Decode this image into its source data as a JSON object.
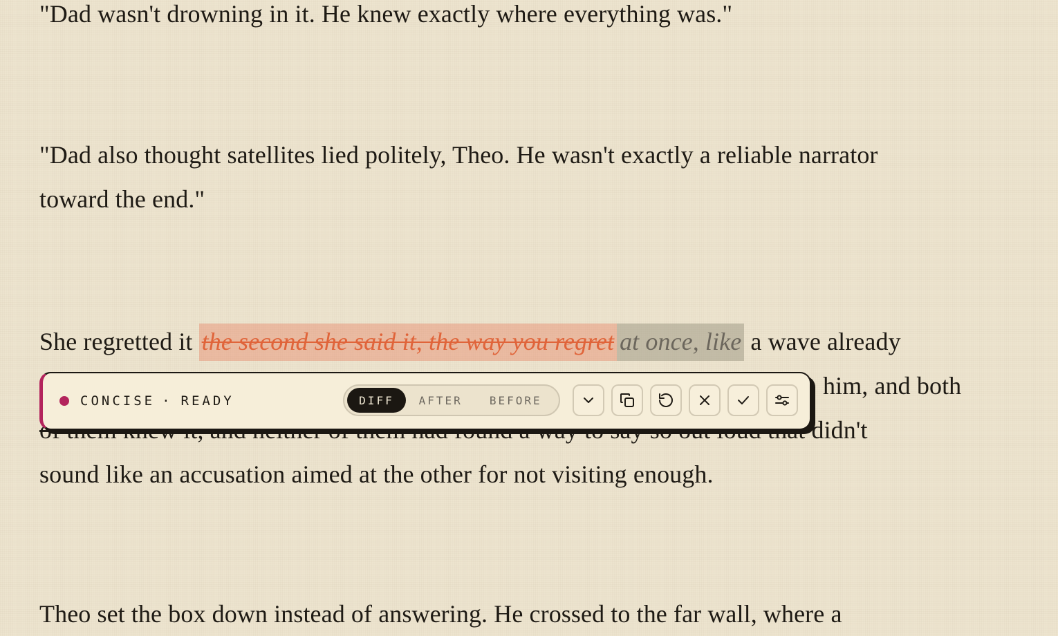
{
  "document": {
    "paragraph_1": "\"Dad wasn't drowning in it. He knew exactly where everything was.\"",
    "paragraph_2_line_1": "\"Dad also thought satellites lied politely, Theo. He wasn't exactly a reliable narrator",
    "paragraph_2_line_2": "toward the end.\"",
    "paragraph_3_prefix": "She regretted it",
    "paragraph_3_deleted": "the second she said it, the way you regret",
    "paragraph_3_inserted": "at once, like",
    "paragraph_3_line_1_rest": "a wave already",
    "paragraph_3_line_2_visible_end": "him, and both",
    "paragraph_3_line_3_struck": "of them knew it, and neither of them had found a way to say so out loud",
    "paragraph_3_line_3_end": "that didn't",
    "paragraph_3_line_4": "sound like an accusation aimed at the other for not visiting enough.",
    "paragraph_4_line_1": "Theo set the box down instead of answering. He crossed to the far wall, where a"
  },
  "toolbar": {
    "mode_label": "CONCISE",
    "separator": "·",
    "status_label": "READY",
    "accent_color": "#b3245c",
    "view_tabs": [
      "DIFF",
      "AFTER",
      "BEFORE"
    ],
    "active_view": "DIFF",
    "actions": [
      {
        "icon": "chevron-down-icon"
      },
      {
        "icon": "copy-icon"
      },
      {
        "icon": "undo-icon"
      },
      {
        "icon": "close-icon"
      },
      {
        "icon": "check-icon"
      },
      {
        "icon": "settings-sliders-icon"
      }
    ]
  },
  "colors": {
    "background": "#ede4cf",
    "deleted_text": "#e0643a",
    "inserted_text": "#6b665c",
    "toolbar_background": "#f6eed9"
  }
}
